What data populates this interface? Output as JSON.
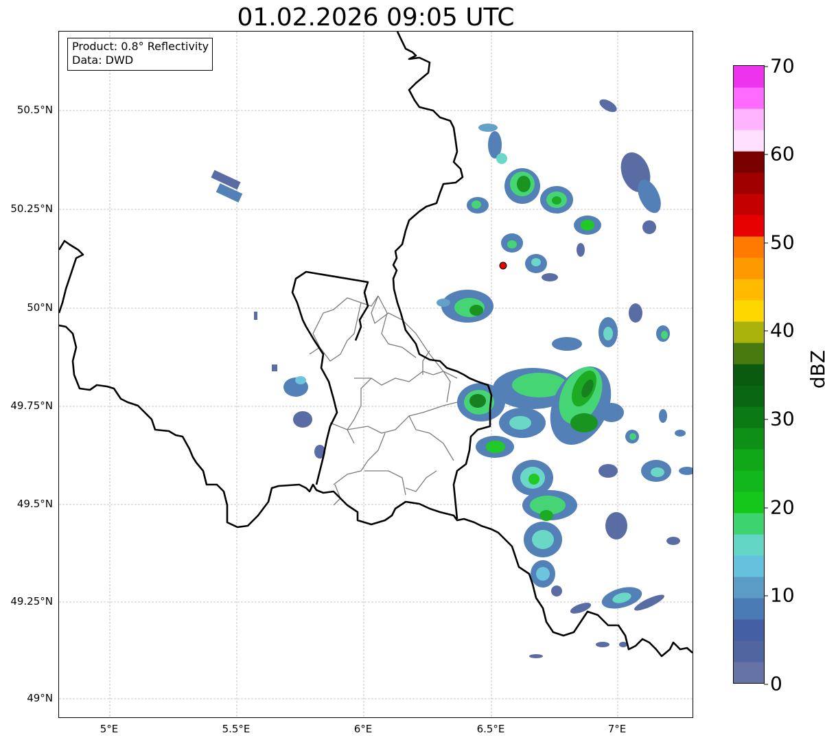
{
  "title": "01.02.2026 09:05 UTC",
  "infobox": {
    "product": "Product: 0.8° Reflectivity",
    "data": "Data: DWD"
  },
  "axes": {
    "x_ticks": [
      "5°E",
      "5.5°E",
      "6°E",
      "6.5°E",
      "7°E"
    ],
    "y_ticks": [
      "50.5°N",
      "50.25°N",
      "50°N",
      "49.75°N",
      "49.5°N",
      "49.25°N",
      "49°N"
    ]
  },
  "colorbar": {
    "label": "dBZ",
    "ticks": [
      "0",
      "10",
      "20",
      "30",
      "40",
      "50",
      "60",
      "70"
    ],
    "range": [
      0,
      70
    ],
    "colors": [
      "#6573a6",
      "#5165a0",
      "#445fa4",
      "#4a7ab3",
      "#5b9cc6",
      "#65c1dd",
      "#62d5c4",
      "#3dd36e",
      "#16c71b",
      "#12b71b",
      "#10a718",
      "#0e8f15",
      "#0b7a14",
      "#0a6612",
      "#0a5a10",
      "#497a10",
      "#aab20c",
      "#ffd700",
      "#ffbb00",
      "#ff9900",
      "#ff7a00",
      "#e60000",
      "#c40000",
      "#a00000",
      "#7a0000",
      "#ffe1ff",
      "#ffb4ff",
      "#ff6bff",
      "#ee33ee"
    ]
  },
  "map": {
    "extent_lon": [
      4.8,
      7.3
    ],
    "extent_lat": [
      48.95,
      50.7
    ],
    "grid": true,
    "radar_site": {
      "lon": 6.55,
      "lat": 50.11
    }
  }
}
